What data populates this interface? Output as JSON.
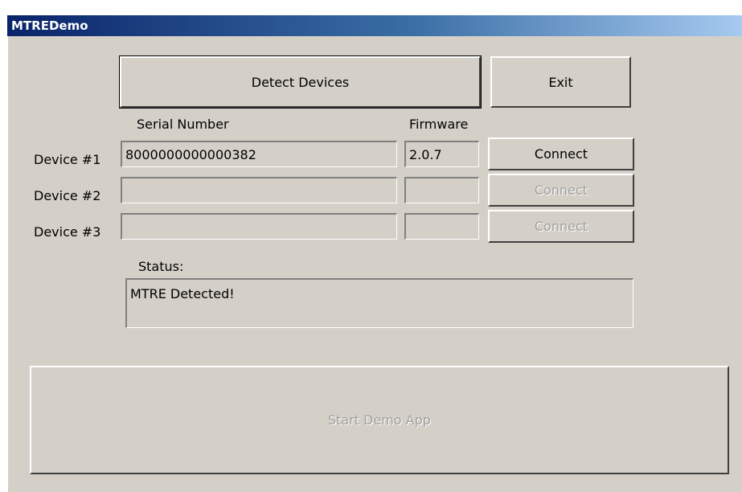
{
  "window": {
    "title": "MTREDemo"
  },
  "buttons": {
    "detect": "Detect Devices",
    "exit": "Exit",
    "start_demo": "Start Demo App"
  },
  "headers": {
    "serial": "Serial Number",
    "firmware": "Firmware"
  },
  "devices": [
    {
      "label": "Device #1",
      "serial": "8000000000000382",
      "firmware": "2.0.7",
      "connect_label": "Connect",
      "connect_enabled": true
    },
    {
      "label": "Device #2",
      "serial": "",
      "firmware": "",
      "connect_label": "Connect",
      "connect_enabled": false
    },
    {
      "label": "Device #3",
      "serial": "",
      "firmware": "",
      "connect_label": "Connect",
      "connect_enabled": false
    }
  ],
  "status": {
    "label": "Status:",
    "text": "MTRE Detected!"
  }
}
